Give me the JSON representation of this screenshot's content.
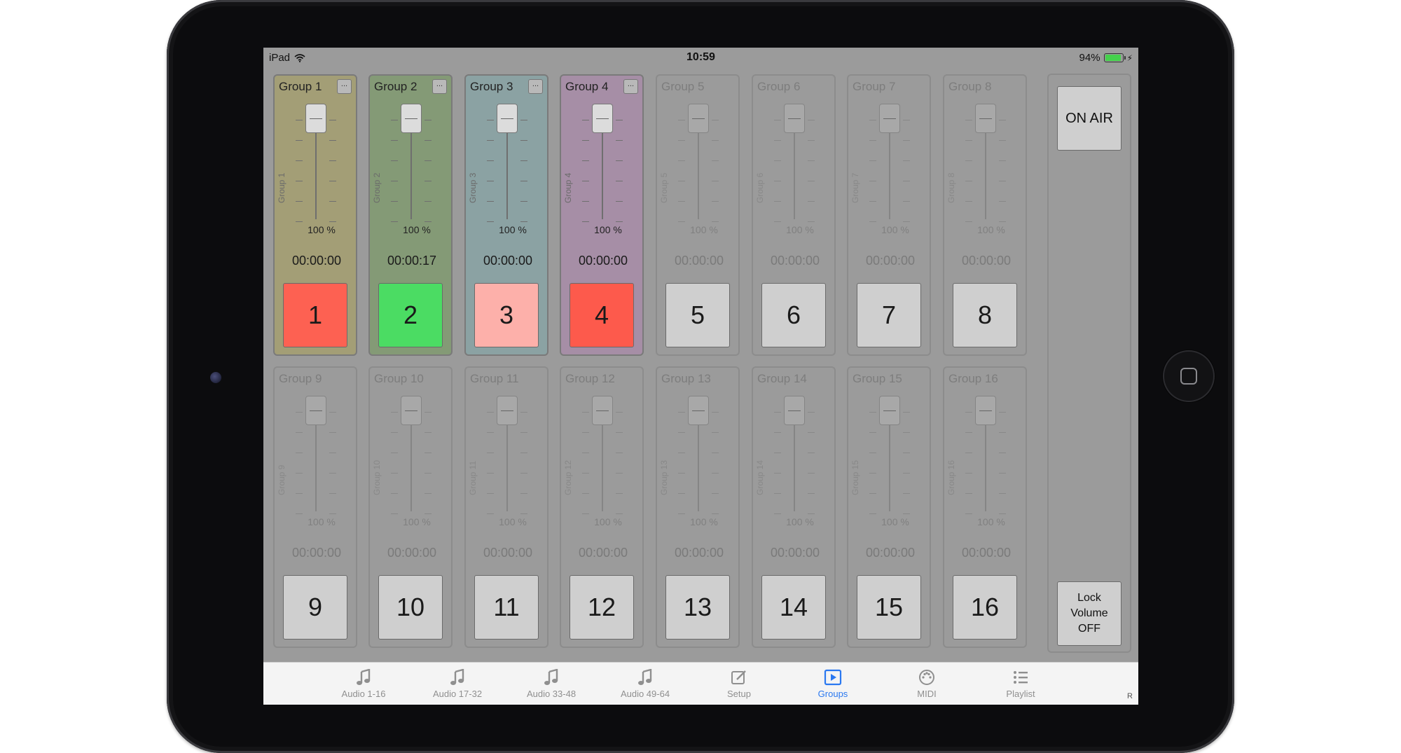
{
  "status_bar": {
    "device": "iPad",
    "time": "10:59",
    "battery": "94%"
  },
  "side": {
    "on_air": "ON AIR",
    "lock_lines": [
      "Lock",
      "Volume",
      "OFF"
    ]
  },
  "groups": [
    {
      "title": "Group 1",
      "side": "Group 1",
      "percent": "100 %",
      "time": "00:00:00",
      "number": "1",
      "active": true,
      "bg": "#a39e76",
      "btn": "#fd6152"
    },
    {
      "title": "Group 2",
      "side": "Group 2",
      "percent": "100 %",
      "time": "00:00:17",
      "number": "2",
      "active": true,
      "bg": "#849a76",
      "btn": "#4bdc63"
    },
    {
      "title": "Group 3",
      "side": "Group 3",
      "percent": "100 %",
      "time": "00:00:00",
      "number": "3",
      "active": true,
      "bg": "#8ba2a3",
      "btn": "#fdb0aa"
    },
    {
      "title": "Group 4",
      "side": "Group 4",
      "percent": "100 %",
      "time": "00:00:00",
      "number": "4",
      "active": true,
      "bg": "#a68ea6",
      "btn": "#fd5a4c"
    },
    {
      "title": "Group 5",
      "side": "Group 5",
      "percent": "100 %",
      "time": "00:00:00",
      "number": "5",
      "active": false
    },
    {
      "title": "Group 6",
      "side": "Group 6",
      "percent": "100 %",
      "time": "00:00:00",
      "number": "6",
      "active": false
    },
    {
      "title": "Group 7",
      "side": "Group 7",
      "percent": "100 %",
      "time": "00:00:00",
      "number": "7",
      "active": false
    },
    {
      "title": "Group 8",
      "side": "Group 8",
      "percent": "100 %",
      "time": "00:00:00",
      "number": "8",
      "active": false
    },
    {
      "title": "Group 9",
      "side": "Group 9",
      "percent": "100 %",
      "time": "00:00:00",
      "number": "9",
      "active": false
    },
    {
      "title": "Group 10",
      "side": "Group 10",
      "percent": "100 %",
      "time": "00:00:00",
      "number": "10",
      "active": false
    },
    {
      "title": "Group 11",
      "side": "Group 11",
      "percent": "100 %",
      "time": "00:00:00",
      "number": "11",
      "active": false
    },
    {
      "title": "Group 12",
      "side": "Group 12",
      "percent": "100 %",
      "time": "00:00:00",
      "number": "12",
      "active": false
    },
    {
      "title": "Group 13",
      "side": "Group 13",
      "percent": "100 %",
      "time": "00:00:00",
      "number": "13",
      "active": false
    },
    {
      "title": "Group 14",
      "side": "Group 14",
      "percent": "100 %",
      "time": "00:00:00",
      "number": "14",
      "active": false
    },
    {
      "title": "Group 15",
      "side": "Group 15",
      "percent": "100 %",
      "time": "00:00:00",
      "number": "15",
      "active": false
    },
    {
      "title": "Group 16",
      "side": "Group 16",
      "percent": "100 %",
      "time": "00:00:00",
      "number": "16",
      "active": false
    }
  ],
  "more_label": "...",
  "tabs": [
    {
      "label": "Audio 1-16",
      "icon": "music-note-icon",
      "selected": false
    },
    {
      "label": "Audio 17-32",
      "icon": "music-note-icon",
      "selected": false
    },
    {
      "label": "Audio 33-48",
      "icon": "music-note-icon",
      "selected": false
    },
    {
      "label": "Audio 49-64",
      "icon": "music-note-icon",
      "selected": false
    },
    {
      "label": "Setup",
      "icon": "edit-icon",
      "selected": false
    },
    {
      "label": "Groups",
      "icon": "play-icon",
      "selected": true
    },
    {
      "label": "MIDI",
      "icon": "midi-icon",
      "selected": false
    },
    {
      "label": "Playlist",
      "icon": "list-icon",
      "selected": false
    }
  ],
  "tab_corner": "R",
  "colors": {
    "accent": "#2a78f0",
    "screen_bg": "#9b9b9b",
    "inactive_button": "#cfcfcf"
  }
}
